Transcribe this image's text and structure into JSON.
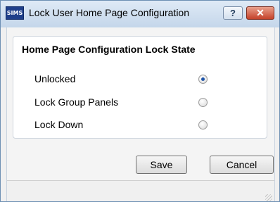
{
  "window": {
    "app_icon_text": "SIMS",
    "title": "Lock User Home Page Configuration",
    "help_glyph": "?",
    "close_glyph": "✕"
  },
  "group": {
    "title": "Home Page Configuration Lock State",
    "options": [
      {
        "label": "Unlocked",
        "selected": true
      },
      {
        "label": "Lock Group Panels",
        "selected": false
      },
      {
        "label": "Lock Down",
        "selected": false
      }
    ]
  },
  "buttons": {
    "save_label": "Save",
    "cancel_label": "Cancel"
  }
}
